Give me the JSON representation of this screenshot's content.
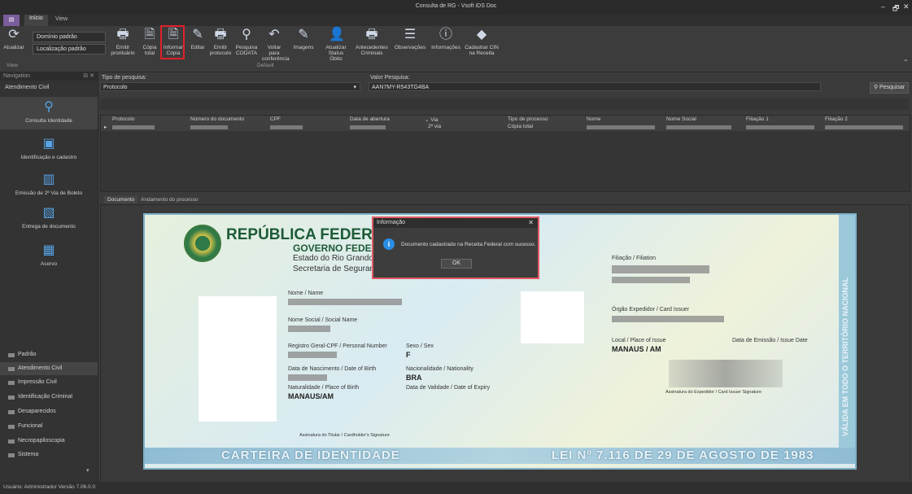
{
  "window": {
    "title": "Consulta de RG - Vsoft iDS Doc",
    "controls": [
      "–",
      "🗗",
      "✕"
    ]
  },
  "ribbon_tabs": [
    "Início",
    "View"
  ],
  "ribbon": {
    "combos": [
      "Domínio padrão",
      "Localização padrão"
    ],
    "left_button": "Atualizar",
    "buttons": [
      {
        "label": "Emitir prontuário",
        "icon": "printer-icon"
      },
      {
        "label": "Cópia total",
        "icon": "document-icon"
      },
      {
        "label": "Informar Cópia",
        "icon": "document-icon"
      },
      {
        "label": "Editar",
        "icon": "edit-icon"
      },
      {
        "label": "Emitir protocolo",
        "icon": "printer-icon"
      },
      {
        "label": "Pesquisa CODATA",
        "icon": "search-icon"
      },
      {
        "label": "Voltar para conferência",
        "icon": "undo-icon"
      },
      {
        "label": "Imagens",
        "icon": "edit-icon"
      },
      {
        "label": "Atualizar Status Óbito",
        "icon": "person-icon"
      },
      {
        "label": "Antecedentes Criminais",
        "icon": "printer-icon"
      },
      {
        "label": "Observações",
        "icon": "list-icon"
      },
      {
        "label": "Informações",
        "icon": "info-icon"
      },
      {
        "label": "Cadastrar CIN na Receita",
        "icon": "receita-icon"
      }
    ],
    "group_labels": [
      "View",
      "Default"
    ]
  },
  "navigation": {
    "header": "Navigation",
    "section": "Atendimento Civil",
    "items": [
      "Consulta Identidade",
      "Identificação e cadastro",
      "Emissão de 2ª Via de Boleto",
      "Entrega de documento",
      "Acervo"
    ],
    "list": [
      "Padrão",
      "Atendimento Civil",
      "Impressão Civil",
      "Identificação Criminal",
      "Desaparecidos",
      "Funcional",
      "Necropapiloscopia",
      "Sistema"
    ],
    "selected": "Atendimento Civil"
  },
  "search": {
    "type_label": "Tipo de pesquisa:",
    "type_value": "Protocolo",
    "value_label": "Valor Pesquisa:",
    "value": "AAN7MY-R543TG4BA",
    "button": "Pesquisar"
  },
  "grid": {
    "columns": [
      "Protocolo",
      "Número do documento",
      "CPF",
      "Data de abertura",
      "Via",
      "Tipo de processo",
      "Nome",
      "Nome Social",
      "Filiação 1",
      "Filiação 2"
    ],
    "row": {
      "via": "2ª via",
      "tipo": "Cópia total"
    }
  },
  "doc_tabs": [
    "Documento",
    "Andamento do processo"
  ],
  "card": {
    "title": "REPÚBLICA FEDERATIVA",
    "gov": "GOVERNO FEDERA",
    "state": "Estado do Rio Grando do",
    "sec": "Secretaria de Segurança P",
    "name_label": "Nome / Name",
    "social_label": "Nome Social / Social Name",
    "cpf_label": "Registro Geral-CPF / Personal Number",
    "sex_label": "Sexo / Sex",
    "sex_value": "F",
    "birth_label": "Data de Nascimento / Date of Birth",
    "nat_label": "Nacionalidade / Nationality",
    "nat_value": "BRA",
    "place_label": "Naturalidade / Place of Birth",
    "place_value": "MANAUS/AM",
    "expiry_label": "Data de Validade / Date of Expiry",
    "filiation_label": "Filiação / Filiation",
    "issuer_label": "Órgão Expedidor / Card Issuer",
    "issue_place_label": "Local / Place of Issue",
    "issue_place_value": "MANAUS / AM",
    "issue_date_label": "Data de Emissão / Issue Date",
    "holder_sig": "Assinatura do Titular / Cardholder's Signature",
    "issuer_sig": "Assinatura do Expedidor / Card Issuer Signature",
    "footer_left": "CARTEIRA DE IDENTIDADE",
    "footer_right": "LEI Nº 7.116 DE 29 DE AGOSTO DE 1983",
    "side_text": "VÁLIDA EM TODO O TERRITÓRIO NACIONAL"
  },
  "modal": {
    "title": "Informação",
    "message": "Documento cadastrado na Receita Federal com sucesso.",
    "ok": "OK"
  },
  "status": "Usuário: Administrador   Versão 7.06.0.0"
}
